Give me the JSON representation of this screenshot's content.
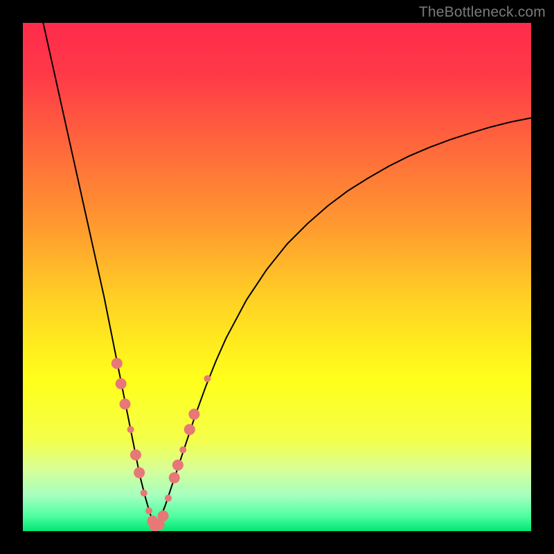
{
  "watermark": "TheBottleneck.com",
  "chart_data": {
    "type": "line",
    "title": "",
    "xlabel": "",
    "ylabel": "",
    "xlim": [
      0,
      100
    ],
    "ylim": [
      0,
      100
    ],
    "grid": false,
    "legend": false,
    "background_gradient_stops": [
      {
        "offset": 0.0,
        "color": "#ff2b4b"
      },
      {
        "offset": 0.1,
        "color": "#ff3948"
      },
      {
        "offset": 0.25,
        "color": "#ff6a3b"
      },
      {
        "offset": 0.4,
        "color": "#ff9a2f"
      },
      {
        "offset": 0.55,
        "color": "#ffd324"
      },
      {
        "offset": 0.7,
        "color": "#ffff1a"
      },
      {
        "offset": 0.82,
        "color": "#f4ff4a"
      },
      {
        "offset": 0.88,
        "color": "#d6ff9a"
      },
      {
        "offset": 0.93,
        "color": "#a5ffbf"
      },
      {
        "offset": 0.97,
        "color": "#4fffa0"
      },
      {
        "offset": 1.0,
        "color": "#00e676"
      }
    ],
    "series": [
      {
        "name": "left-branch",
        "color": "#000000",
        "stroke_width": 2,
        "x": [
          4.0,
          6.0,
          8.0,
          10.0,
          12.0,
          14.0,
          16.0,
          18.0,
          19.0,
          20.0,
          21.0,
          22.0,
          23.0,
          24.0,
          25.0,
          26.0
        ],
        "y": [
          100.0,
          91.0,
          82.0,
          73.0,
          64.0,
          55.0,
          46.0,
          36.0,
          31.0,
          26.0,
          21.0,
          16.0,
          11.0,
          7.0,
          3.5,
          1.0
        ]
      },
      {
        "name": "right-branch",
        "color": "#000000",
        "stroke_width": 2,
        "x": [
          26.0,
          27.0,
          28.0,
          29.0,
          30.0,
          32.0,
          34.0,
          36.0,
          38.0,
          40.0,
          44.0,
          48.0,
          52.0,
          56.0,
          60.0,
          64.0,
          68.0,
          72.0,
          76.0,
          80.0,
          84.0,
          88.0,
          92.0,
          96.0,
          100.0
        ],
        "y": [
          1.0,
          2.5,
          5.0,
          8.0,
          11.0,
          17.0,
          23.0,
          28.5,
          33.5,
          38.0,
          45.5,
          51.5,
          56.5,
          60.5,
          64.0,
          67.0,
          69.5,
          71.8,
          73.8,
          75.5,
          77.0,
          78.3,
          79.5,
          80.5,
          81.3
        ]
      }
    ],
    "markers": {
      "color": "#e87777",
      "radius_small": 5,
      "radius_large": 8,
      "points": [
        {
          "x": 18.5,
          "y": 33.0,
          "r": 8
        },
        {
          "x": 19.3,
          "y": 29.0,
          "r": 8
        },
        {
          "x": 20.1,
          "y": 25.0,
          "r": 8
        },
        {
          "x": 21.2,
          "y": 20.0,
          "r": 5
        },
        {
          "x": 22.2,
          "y": 15.0,
          "r": 8
        },
        {
          "x": 22.9,
          "y": 11.5,
          "r": 8
        },
        {
          "x": 23.8,
          "y": 7.5,
          "r": 5
        },
        {
          "x": 24.8,
          "y": 4.0,
          "r": 5
        },
        {
          "x": 25.5,
          "y": 2.0,
          "r": 8
        },
        {
          "x": 26.0,
          "y": 1.0,
          "r": 8
        },
        {
          "x": 26.8,
          "y": 1.3,
          "r": 8
        },
        {
          "x": 27.6,
          "y": 3.0,
          "r": 8
        },
        {
          "x": 28.6,
          "y": 6.5,
          "r": 5
        },
        {
          "x": 29.8,
          "y": 10.5,
          "r": 8
        },
        {
          "x": 30.5,
          "y": 13.0,
          "r": 8
        },
        {
          "x": 31.5,
          "y": 16.0,
          "r": 5
        },
        {
          "x": 32.8,
          "y": 20.0,
          "r": 8
        },
        {
          "x": 33.7,
          "y": 23.0,
          "r": 8
        },
        {
          "x": 36.3,
          "y": 30.0,
          "r": 5
        }
      ]
    }
  }
}
